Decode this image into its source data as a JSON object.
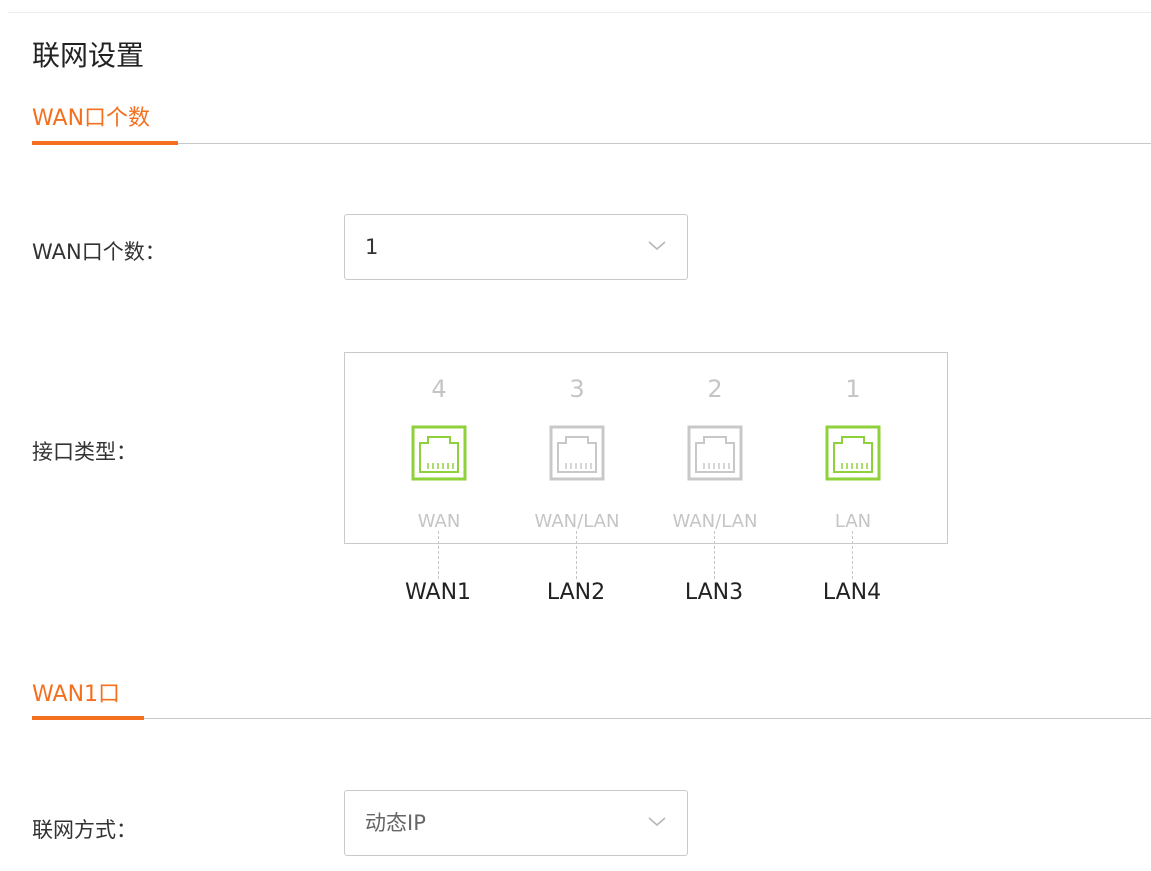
{
  "page": {
    "title": "联网设置"
  },
  "wan_count_section": {
    "tab_label": "WAN口个数",
    "field_label": "WAN口个数：",
    "select_value": "1"
  },
  "interface_type": {
    "field_label": "接口类型：",
    "ports": [
      {
        "number": "4",
        "type": "WAN",
        "name": "WAN1",
        "active": true
      },
      {
        "number": "3",
        "type": "WAN/LAN",
        "name": "LAN2",
        "active": false
      },
      {
        "number": "2",
        "type": "WAN/LAN",
        "name": "LAN3",
        "active": false
      },
      {
        "number": "1",
        "type": "LAN",
        "name": "LAN4",
        "active": true
      }
    ],
    "active_color": "#8fd13a",
    "inactive_color": "#c8c8c8"
  },
  "wan1_section": {
    "tab_label": "WAN1口",
    "field_label": "联网方式：",
    "select_value": "动态IP"
  },
  "colors": {
    "accent": "#f4701e"
  }
}
